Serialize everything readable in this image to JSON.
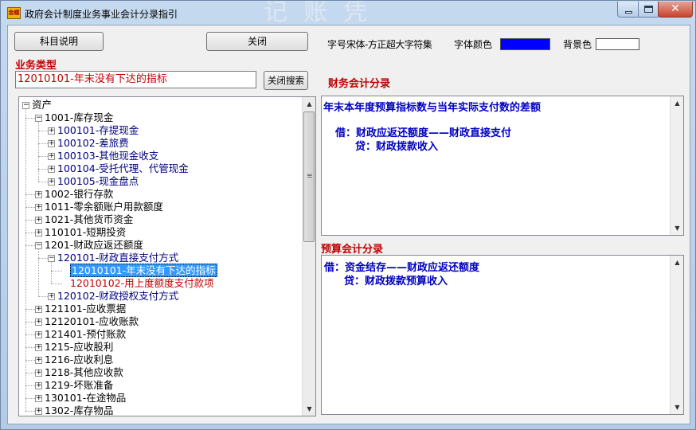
{
  "window": {
    "title": "政府会计制度业务事业会计分录指引",
    "icon_text": "金蝶",
    "bg_text": "记账凭证"
  },
  "toolbar": {
    "subject_button": "科目说明",
    "close_button": "关闭",
    "font_label": "字号",
    "font_name": "宋体-方正超大字符集",
    "font_color_label": "字体颜色",
    "font_color": "#0000ff",
    "bg_color_label": "背景色",
    "bg_color": "#ffffff"
  },
  "business": {
    "title": "业务类型",
    "search_value": "12010101-年末没有下达的指标",
    "close_search_button": "关闭搜索"
  },
  "tree": {
    "nodes": [
      {
        "label": "资产",
        "level": 0,
        "expand": "minus",
        "color": "#000"
      },
      {
        "label": "1001-库存现金",
        "level": 1,
        "expand": "minus",
        "color": "#000"
      },
      {
        "label": "100101-存提现金",
        "level": 2,
        "expand": "plus",
        "color": "#000080"
      },
      {
        "label": "100102-差旅费",
        "level": 2,
        "expand": "plus",
        "color": "#000080"
      },
      {
        "label": "100103-其他现金收支",
        "level": 2,
        "expand": "plus",
        "color": "#000080"
      },
      {
        "label": "100104-受托代理、代管现金",
        "level": 2,
        "expand": "plus",
        "color": "#000080"
      },
      {
        "label": "100105-现金盘点",
        "level": 2,
        "expand": "plus",
        "color": "#000080"
      },
      {
        "label": "1002-银行存款",
        "level": 1,
        "expand": "plus",
        "color": "#000"
      },
      {
        "label": "1011-零余额账户用款额度",
        "level": 1,
        "expand": "plus",
        "color": "#000"
      },
      {
        "label": "1021-其他货币资金",
        "level": 1,
        "expand": "plus",
        "color": "#000"
      },
      {
        "label": "110101-短期投资",
        "level": 1,
        "expand": "plus",
        "color": "#000"
      },
      {
        "label": "1201-财政应返还额度",
        "level": 1,
        "expand": "minus",
        "color": "#000"
      },
      {
        "label": "120101-财政直接支付方式",
        "level": 2,
        "expand": "minus",
        "color": "#000080"
      },
      {
        "label": "12010101-年末没有下达的指标",
        "level": 3,
        "expand": "none",
        "color": "#c00000",
        "selected": true
      },
      {
        "label": "12010102-用上度额度支付款项",
        "level": 3,
        "expand": "none",
        "color": "#c00000"
      },
      {
        "label": "120102-财政授权支付方式",
        "level": 2,
        "expand": "plus",
        "color": "#000080"
      },
      {
        "label": "121101-应收票据",
        "level": 1,
        "expand": "plus",
        "color": "#000"
      },
      {
        "label": "12120101-应收账款",
        "level": 1,
        "expand": "plus",
        "color": "#000"
      },
      {
        "label": "121401-预付账款",
        "level": 1,
        "expand": "plus",
        "color": "#000"
      },
      {
        "label": "1215-应收股利",
        "level": 1,
        "expand": "plus",
        "color": "#000"
      },
      {
        "label": "1216-应收利息",
        "level": 1,
        "expand": "plus",
        "color": "#000"
      },
      {
        "label": "1218-其他应收款",
        "level": 1,
        "expand": "plus",
        "color": "#000"
      },
      {
        "label": "1219-坏账准备",
        "level": 1,
        "expand": "plus",
        "color": "#000"
      },
      {
        "label": "130101-在途物品",
        "level": 1,
        "expand": "plus",
        "color": "#000"
      },
      {
        "label": "1302-库存物品",
        "level": 1,
        "expand": "plus",
        "color": "#000"
      }
    ]
  },
  "financial": {
    "title": "财务会计分录",
    "line1": "年末本年度预算指标数与当年实际支付数的差额",
    "line2": "借：财政应返还额度——财政直接支付",
    "line3": "贷：财政拨款收入"
  },
  "budget": {
    "title": "预算会计分录",
    "line1": "借：资金结存——财政应返还额度",
    "line2": "贷：财政拨款预算收入"
  }
}
